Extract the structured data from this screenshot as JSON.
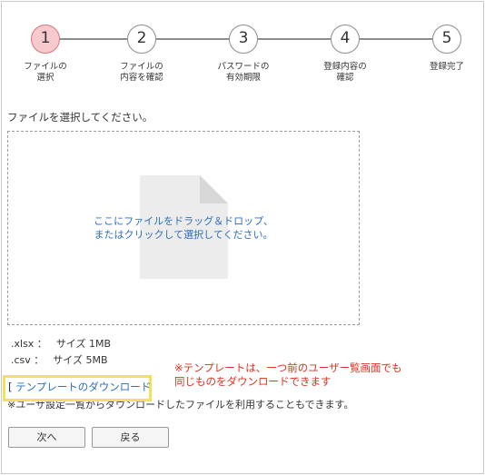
{
  "steps": [
    {
      "number": "1",
      "line1": "ファイルの",
      "line2": "選択",
      "active": true
    },
    {
      "number": "2",
      "line1": "ファイルの",
      "line2": "内容を確認",
      "active": false
    },
    {
      "number": "3",
      "line1": "パスワードの",
      "line2": "有効期限",
      "active": false
    },
    {
      "number": "4",
      "line1": "登録内容の",
      "line2": "確認",
      "active": false
    },
    {
      "number": "5",
      "line1": "登録完了",
      "line2": "",
      "active": false
    }
  ],
  "colors": {
    "active_step_fill": "#f6c9cc",
    "active_step_border": "#d9747c",
    "link_blue": "#2b6fbf",
    "note_red": "#e0301e",
    "highlight_yellow": "#f3e05c"
  },
  "instruction": "ファイルを選択してください。",
  "dropzone": {
    "line1": "ここにファイルをドラッグ＆ドロップ、",
    "line2": "またはクリックして選択してください。",
    "icon": "file-icon"
  },
  "formats": [
    {
      "ext": ".xlsx ：",
      "size": "サイズ 1MB"
    },
    {
      "ext": ".csv ：",
      "size": "サイズ 5MB"
    }
  ],
  "template": {
    "bracket": "[",
    "link": "テンプレートのダウンロード"
  },
  "annotation": {
    "line1": "※テンプレートは、一つ前のユーザー覧画面でも",
    "line2": "同じものをダウンロードできます"
  },
  "subnote": "※ユーザ設定一覧からダウンロードしたファイルを利用することもできます。",
  "buttons": {
    "next": "次へ",
    "back": "戻る"
  }
}
